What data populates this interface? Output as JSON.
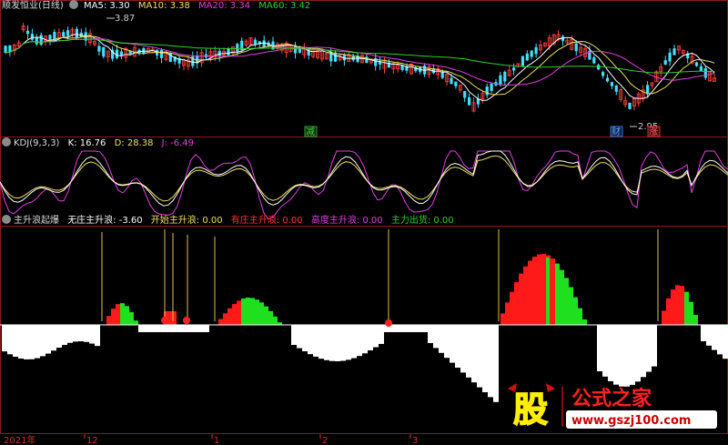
{
  "panels": {
    "price": {
      "title": "顺发恒业(日线)",
      "ma": [
        {
          "label": "MA5: 3.30",
          "color": "#ffffff"
        },
        {
          "label": "MA10: 3.38",
          "color": "#f0e060"
        },
        {
          "label": "MA20: 3.34",
          "color": "#e040e0"
        },
        {
          "label": "MA60: 3.42",
          "color": "#30d030"
        }
      ],
      "high_mark": "3.87",
      "low_mark": "2.95",
      "tags": [
        {
          "text": "减",
          "color": "#30a030"
        },
        {
          "text": "财",
          "color": "#3070d0"
        },
        {
          "text": "涨",
          "color": "#d03030"
        }
      ]
    },
    "kdj": {
      "title": "KDJ(9,3,3)",
      "k": "K: 16.76",
      "d": "D: 28.38",
      "j": "J: -6.49"
    },
    "indicator": {
      "title": "主升浪起爆",
      "items": [
        {
          "label": "无庄主升浪: -3.60",
          "color": "#ffffff"
        },
        {
          "label": "开始主升浪: 0.00",
          "color": "#f0e060"
        },
        {
          "label": "有庄主升浪: 0.00",
          "color": "#ff3030"
        },
        {
          "label": "高度主升浪: 0.00",
          "color": "#e040e0"
        },
        {
          "label": "主力出货: 0.00",
          "color": "#30d030"
        }
      ]
    }
  },
  "x_axis": [
    "2021年",
    "12",
    "1",
    "2",
    "3"
  ],
  "watermark": {
    "big": "股",
    "text": "公式之家",
    "url": "www.gszj100.com"
  },
  "chart_data": {
    "type": "bar",
    "ylim": [
      -4,
      4
    ]
  }
}
